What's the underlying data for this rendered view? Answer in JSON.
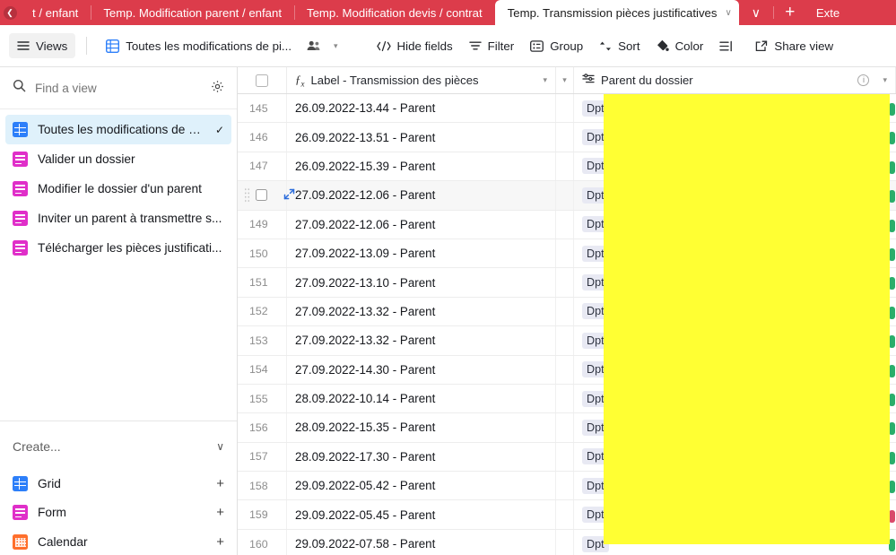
{
  "tabbar": {
    "back_icon": "back-arrow-icon",
    "tabs": [
      {
        "label": "t / enfant",
        "active": false
      },
      {
        "label": "Temp. Modification parent / enfant",
        "active": false
      },
      {
        "label": "Temp. Modification devis / contrat",
        "active": false
      },
      {
        "label": "Temp. Transmission pièces justificatives",
        "active": true
      }
    ],
    "active_tab_caret": "∨",
    "chevron_label": "∨",
    "plus_label": "+",
    "overflow_label": "Exte"
  },
  "toolbar": {
    "views_label": "Views",
    "views_icon": "hamburger-icon",
    "view_name": "Toutes les modifications de pi...",
    "view_icon": "grid-view-icon",
    "collaborators_icon": "collaborators-icon",
    "view_caret": "▾",
    "buttons": [
      {
        "label": "Hide fields",
        "icon": "hide-fields-icon"
      },
      {
        "label": "Filter",
        "icon": "filter-icon"
      },
      {
        "label": "Group",
        "icon": "group-icon"
      },
      {
        "label": "Sort",
        "icon": "sort-icon"
      },
      {
        "label": "Color",
        "icon": "color-icon"
      },
      {
        "label": "",
        "icon": "row-height-icon"
      },
      {
        "label": "Share view",
        "icon": "share-icon"
      }
    ]
  },
  "sidebar": {
    "search": {
      "placeholder": "Find a view",
      "icon": "search-icon"
    },
    "settings_icon": "gear-icon",
    "views": [
      {
        "label": "Toutes les modifications de pi...",
        "type": "grid",
        "selected": true,
        "check": "✓"
      },
      {
        "label": "Valider un dossier",
        "type": "form",
        "selected": false,
        "check": ""
      },
      {
        "label": "Modifier le dossier d'un parent",
        "type": "form",
        "selected": false,
        "check": ""
      },
      {
        "label": "Inviter un parent à transmettre s...",
        "type": "form",
        "selected": false,
        "check": ""
      },
      {
        "label": "Télécharger les pièces justificati...",
        "type": "form",
        "selected": false,
        "check": ""
      }
    ],
    "create": {
      "title": "Create...",
      "caret": "∨",
      "items": [
        {
          "label": "Grid",
          "type": "grid",
          "add": "+"
        },
        {
          "label": "Form",
          "type": "form",
          "add": "+"
        },
        {
          "label": "Calendar",
          "type": "calendar",
          "add": "+"
        }
      ]
    }
  },
  "grid": {
    "header": {
      "select_all_icon": "checkbox-icon",
      "col1": {
        "label": "Label - Transmission des pièces",
        "icon": "formula-icon",
        "caret": "▾"
      },
      "col_narrow_caret": "▾",
      "col2": {
        "label": "Parent du dossier",
        "icon": "link-field-icon",
        "info": "i",
        "caret": "▾"
      }
    },
    "rows": [
      {
        "num": "145",
        "label": "26.09.2022-13.44 - Parent",
        "chip": "Dpt",
        "status_color": "#2aae6a",
        "hovered": false
      },
      {
        "num": "146",
        "label": "26.09.2022-13.51 - Parent",
        "chip": "Dpt",
        "status_color": "#2aae6a",
        "hovered": false
      },
      {
        "num": "147",
        "label": "26.09.2022-15.39 - Parent",
        "chip": "Dpt",
        "status_color": "#2aae6a",
        "hovered": false
      },
      {
        "num": "148",
        "label": "27.09.2022-12.06 - Parent",
        "chip": "Dpt",
        "status_color": "#2aae6a",
        "hovered": true
      },
      {
        "num": "149",
        "label": "27.09.2022-12.06 - Parent",
        "chip": "Dpt",
        "status_color": "#2aae6a",
        "hovered": false
      },
      {
        "num": "150",
        "label": "27.09.2022-13.09 - Parent",
        "chip": "Dpt",
        "status_color": "#2aae6a",
        "hovered": false
      },
      {
        "num": "151",
        "label": "27.09.2022-13.10 - Parent",
        "chip": "Dpt",
        "status_color": "#2aae6a",
        "hovered": false
      },
      {
        "num": "152",
        "label": "27.09.2022-13.32 - Parent",
        "chip": "Dpt",
        "status_color": "#2aae6a",
        "hovered": false
      },
      {
        "num": "153",
        "label": "27.09.2022-13.32 - Parent",
        "chip": "Dpt",
        "status_color": "#2aae6a",
        "hovered": false
      },
      {
        "num": "154",
        "label": "27.09.2022-14.30 - Parent",
        "chip": "Dpt",
        "status_color": "#2aae6a",
        "hovered": false
      },
      {
        "num": "155",
        "label": "28.09.2022-10.14 - Parent",
        "chip": "Dpt",
        "status_color": "#2aae6a",
        "hovered": false
      },
      {
        "num": "156",
        "label": "28.09.2022-15.35 - Parent",
        "chip": "Dpt",
        "status_color": "#2aae6a",
        "hovered": false
      },
      {
        "num": "157",
        "label": "28.09.2022-17.30 - Parent",
        "chip": "Dpt",
        "status_color": "#2aae6a",
        "hovered": false
      },
      {
        "num": "158",
        "label": "29.09.2022-05.42 - Parent",
        "chip": "Dpt",
        "status_color": "#2aae6a",
        "hovered": false
      },
      {
        "num": "159",
        "label": "29.09.2022-05.45 - Parent",
        "chip": "Dpt",
        "status_color": "#d94a6a",
        "hovered": false
      },
      {
        "num": "160",
        "label": "29.09.2022-07.58 - Parent",
        "chip": "Dpt",
        "status_color": "#2aae6a",
        "hovered": false
      }
    ],
    "row_hover_controls": {
      "drag_icon": "drag-handle-icon",
      "checkbox_icon": "checkbox-icon",
      "expand_icon": "expand-record-icon"
    }
  },
  "overlay": {
    "highlight_color": "#ffff33"
  },
  "colors": {
    "tabbar_red": "#dc3c4b",
    "selected_view_blue": "#dff1fb",
    "grid_icon_blue": "#2d7ff9",
    "form_icon_pink": "#e02fc9",
    "calendar_icon_orange": "#ff6f2c"
  }
}
